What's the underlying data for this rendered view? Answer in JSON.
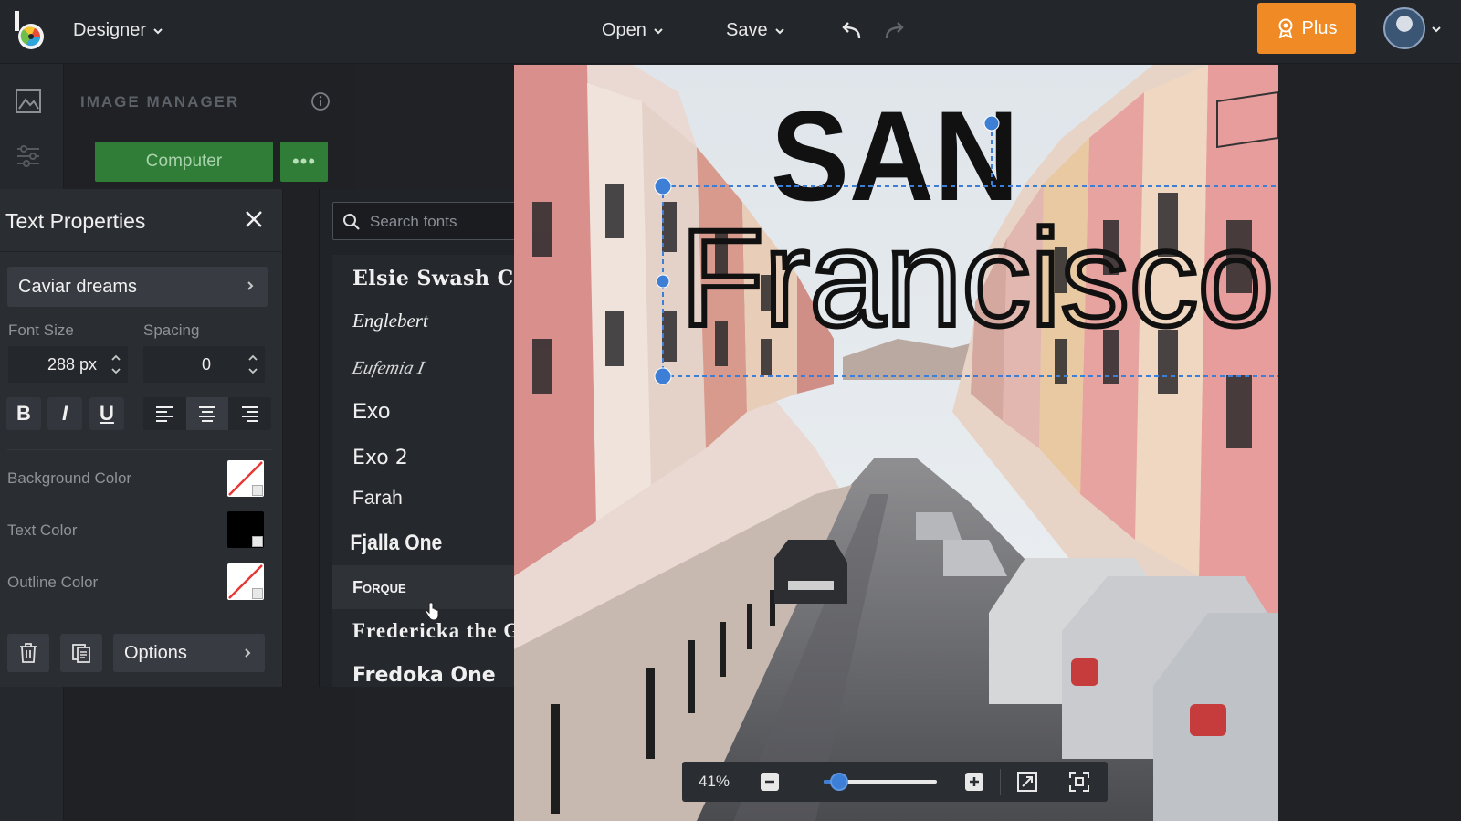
{
  "app": {
    "logo_letter": "b",
    "mode_menu": "Designer"
  },
  "topbar": {
    "open_label": "Open",
    "save_label": "Save",
    "plus_label": "Plus",
    "plus_color": "#f08a24"
  },
  "image_manager": {
    "title": "IMAGE MANAGER",
    "computer_label": "Computer",
    "more_label": "•••"
  },
  "text_properties": {
    "title": "Text Properties",
    "font_name": "Caviar dreams",
    "font_size_label": "Font Size",
    "font_size_value": "288 px",
    "spacing_label": "Spacing",
    "spacing_value": "0",
    "bold_label": "B",
    "italic_label": "I",
    "underline_label": "U",
    "background_color_label": "Background Color",
    "text_color_label": "Text Color",
    "outline_color_label": "Outline Color",
    "text_color": "#000000",
    "options_label": "Options"
  },
  "font_search": {
    "placeholder": "Search fonts",
    "fonts": [
      "Elsie Swash Caps",
      "Englebert",
      "Eufemia I",
      "Exo",
      "Exo 2",
      "Farah",
      "Fjalla One",
      "Forque",
      "Fredericka the Great",
      "Fredoka One"
    ],
    "hovered": "Forque"
  },
  "canvas": {
    "title_line1": "SAN",
    "title_line2": "Francisco",
    "selection_color": "#3d7fd6"
  },
  "zoom": {
    "level_label": "41%",
    "level": 0.14
  }
}
